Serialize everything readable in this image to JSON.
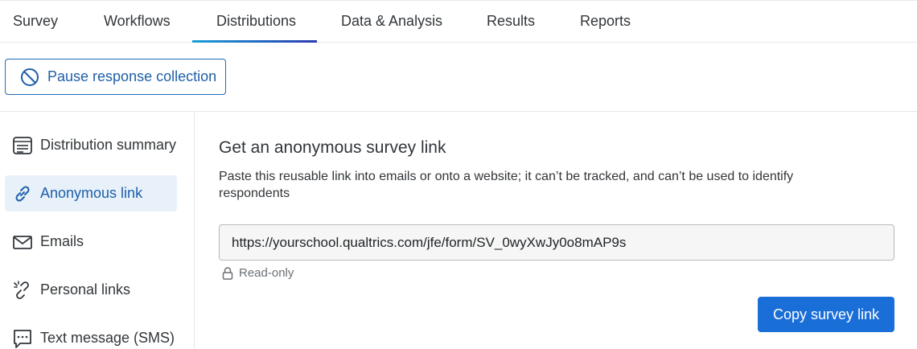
{
  "topnav": {
    "tabs": [
      {
        "label": "Survey"
      },
      {
        "label": "Workflows"
      },
      {
        "label": "Distributions",
        "active": true
      },
      {
        "label": "Data & Analysis"
      },
      {
        "label": "Results"
      },
      {
        "label": "Reports"
      }
    ]
  },
  "pause": {
    "label": "Pause response collection",
    "icon": "prohibited-icon"
  },
  "sidebar": {
    "items": [
      {
        "label": "Distribution summary",
        "icon": "summary-list-icon"
      },
      {
        "label": "Anonymous link",
        "icon": "link-icon",
        "active": true
      },
      {
        "label": "Emails",
        "icon": "envelope-icon"
      },
      {
        "label": "Personal links",
        "icon": "broken-link-icon"
      },
      {
        "label": "Text message (SMS)",
        "icon": "chat-bubble-icon"
      }
    ]
  },
  "main": {
    "heading": "Get an anonymous survey link",
    "description": "Paste this reusable link into emails or onto a website; it can’t be tracked, and can’t be used to identify respondents",
    "url": "https://yourschool.qualtrics.com/jfe/form/SV_0wyXwJy0o8mAP9s",
    "readonly_label": "Read-only",
    "copy_label": "Copy survey link"
  },
  "colors": {
    "accent": "#1e5fa8",
    "primary_button": "#1a6ed8",
    "active_bg": "#e8f1fa"
  }
}
